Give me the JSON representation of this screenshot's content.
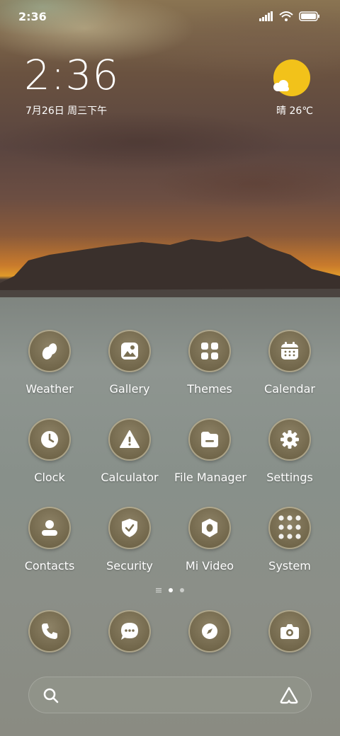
{
  "status_bar": {
    "time": "2:36"
  },
  "widget": {
    "clock": "2:36",
    "date": "7月26日 周三下午",
    "weather": "晴 26℃"
  },
  "apps": [
    {
      "label": "Weather",
      "icon": "weather-icon"
    },
    {
      "label": "Gallery",
      "icon": "gallery-icon"
    },
    {
      "label": "Themes",
      "icon": "themes-icon"
    },
    {
      "label": "Calendar",
      "icon": "calendar-icon"
    },
    {
      "label": "Clock",
      "icon": "clock-icon"
    },
    {
      "label": "Calculator",
      "icon": "calculator-icon"
    },
    {
      "label": "File Manager",
      "icon": "file-manager-icon"
    },
    {
      "label": "Settings",
      "icon": "settings-icon"
    },
    {
      "label": "Contacts",
      "icon": "contacts-icon"
    },
    {
      "label": "Security",
      "icon": "security-icon"
    },
    {
      "label": "Mi Video",
      "icon": "mi-video-icon"
    },
    {
      "label": "System",
      "icon": "system-folder-icon"
    }
  ],
  "page_indicator": {
    "pages": 2,
    "active": 1
  },
  "dock": [
    "phone-icon",
    "messages-icon",
    "browser-icon",
    "camera-icon"
  ],
  "colors": {
    "icon_bg": "#7a6f52",
    "icon_glyph": "#ffffff",
    "sun": "#f2c21a"
  }
}
